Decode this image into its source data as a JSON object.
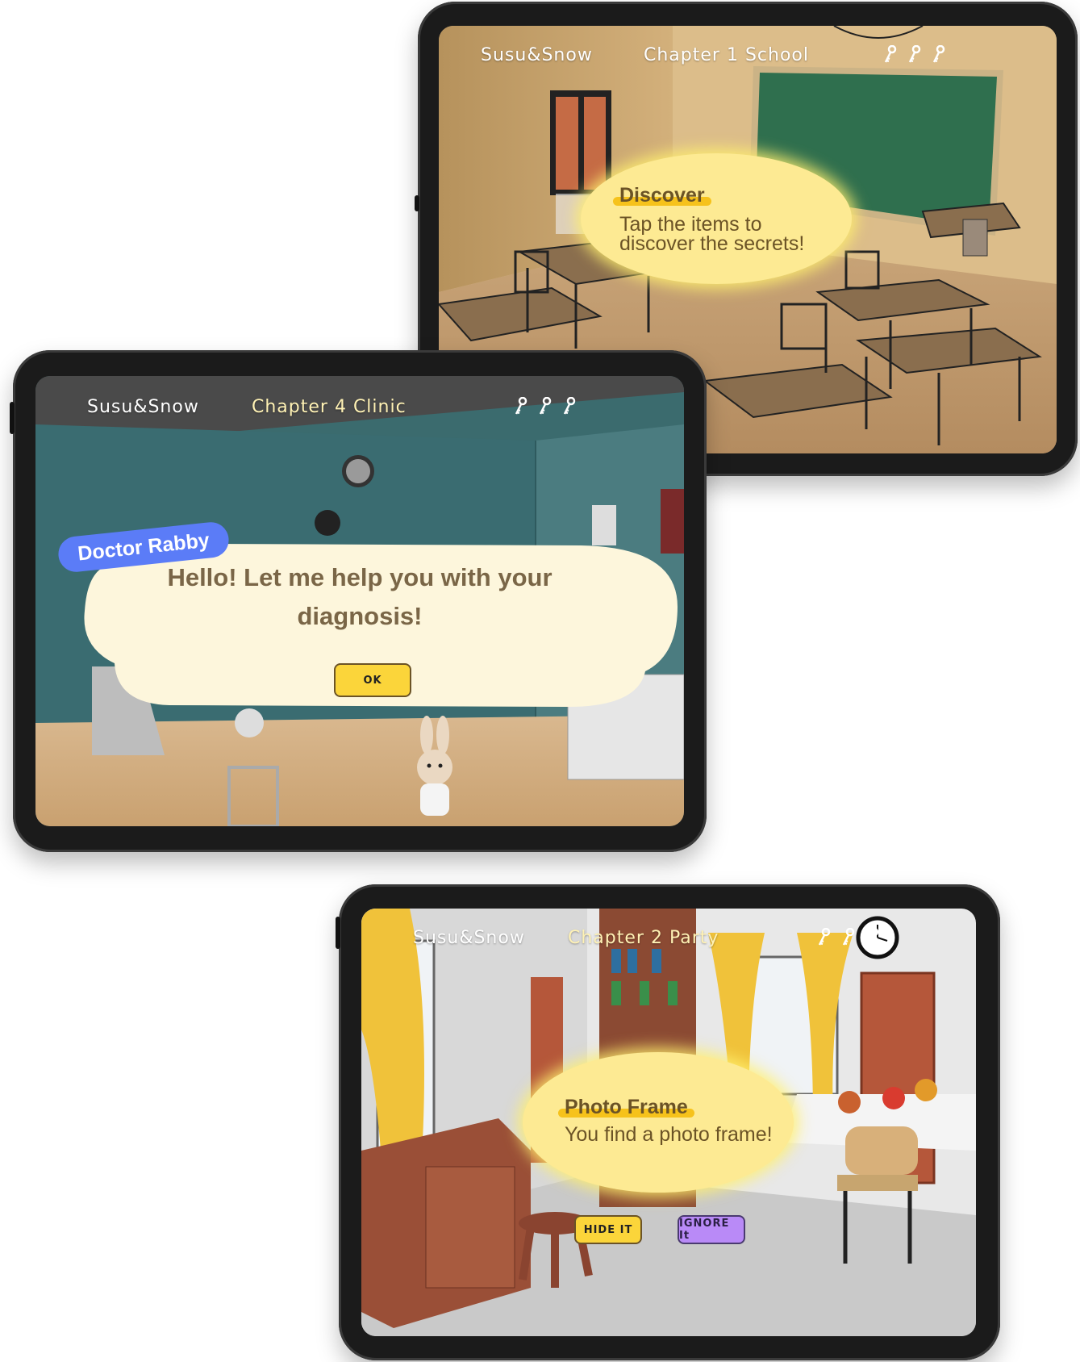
{
  "school": {
    "brand": "Susu&Snow",
    "chapter": "Chapter 1 School",
    "keys": [
      "key-icon",
      "key-icon",
      "key-icon"
    ],
    "bubble": {
      "title": "Discover",
      "line1": "Tap the items to",
      "line2": "discover the secrets!"
    }
  },
  "clinic": {
    "brand": "Susu&Snow",
    "chapter": "Chapter 4 Clinic",
    "keys": [
      "key-icon",
      "key-icon",
      "key-icon"
    ],
    "speaker": "Doctor Rabby",
    "line1": "Hello! Let me help you with your",
    "line2": "diagnosis!",
    "ok_label": "OK"
  },
  "party": {
    "brand": "Susu&Snow",
    "chapter": "Chapter 2 Party",
    "keys": [
      "key-icon",
      "key-icon",
      "key-icon"
    ],
    "bubble": {
      "title": "Photo Frame",
      "text": "You find a photo frame!"
    },
    "hide_label": "HIDE IT",
    "ignore_label": "IGNORE It"
  },
  "colors": {
    "bubble_yellow": "#fdea93",
    "highlight": "#f6c21b",
    "dialog_cream": "#fdf6dc",
    "speaker_blue": "#5b7cf7",
    "ok_yellow": "#fbd53a",
    "ignore_purple": "#b98af7"
  }
}
